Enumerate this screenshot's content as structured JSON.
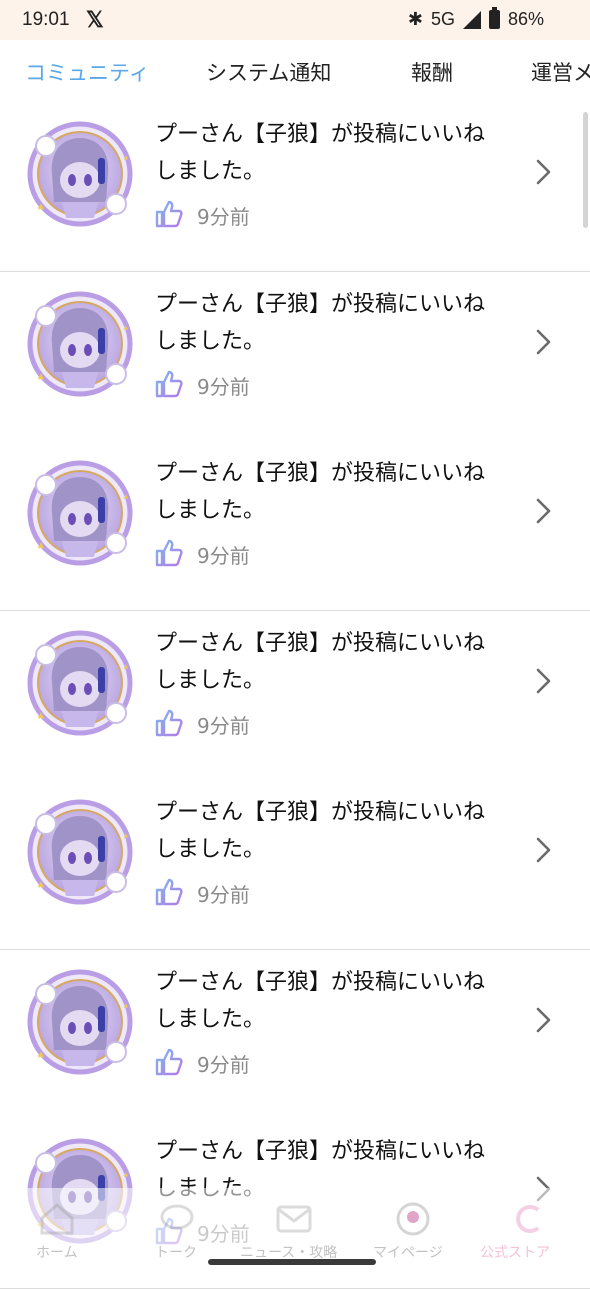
{
  "status_bar": {
    "time": "19:01",
    "network": "5G",
    "battery": "86%",
    "icons": [
      "x-logo-icon",
      "bluetooth-icon",
      "signal-icon",
      "battery-icon"
    ]
  },
  "tabs": [
    {
      "label": "コミュニティ",
      "active": true
    },
    {
      "label": "システム通知",
      "active": false
    },
    {
      "label": "報酬",
      "active": false
    },
    {
      "label": "運営メ",
      "active": false
    }
  ],
  "notifications": [
    {
      "line1": "プーさん【子狼】が投稿にいいね",
      "line2": "しました。",
      "time": "9分前"
    },
    {
      "line1": "プーさん【子狼】が投稿にいいね",
      "line2": "しました。",
      "time": "9分前"
    },
    {
      "line1": "プーさん【子狼】が投稿にいいね",
      "line2": "しました。",
      "time": "9分前"
    },
    {
      "line1": "プーさん【子狼】が投稿にいいね",
      "line2": "しました。",
      "time": "9分前"
    },
    {
      "line1": "プーさん【子狼】が投稿にいいね",
      "line2": "しました。",
      "time": "9分前"
    },
    {
      "line1": "プーさん【子狼】が投稿にいいね",
      "line2": "しました。",
      "time": "9分前"
    },
    {
      "line1": "プーさん【子狼】が投稿にいいね",
      "line2": "しました。",
      "time": "9分前"
    }
  ],
  "bottom_nav": [
    {
      "label": "ホーム",
      "icon": "home-icon"
    },
    {
      "label": "トーク",
      "icon": "chat-icon"
    },
    {
      "label": "ニュース・攻略",
      "icon": "mail-icon"
    },
    {
      "label": "マイページ",
      "icon": "avatar-icon"
    },
    {
      "label": "公式ストア",
      "icon": "store-icon"
    }
  ],
  "colors": {
    "active_tab": "#5aa8e8",
    "like_icon": "#9b7be0",
    "status_bar_bg": "#fdf3ea"
  }
}
